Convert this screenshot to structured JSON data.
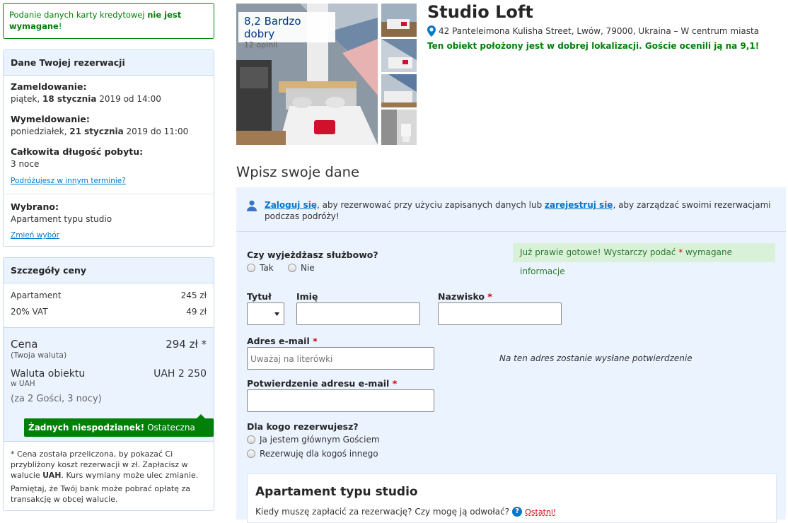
{
  "notice": {
    "pre": "Podanie danych karty kredytowej ",
    "bold": "nie jest wymagane",
    "post": "!"
  },
  "booking": {
    "heading": "Dane Twojej rezerwacji",
    "checkin_label": "Zameldowanie:",
    "checkin_day": "piątek, ",
    "checkin_date": "18 stycznia",
    "checkin_rest": " 2019 od 14:00",
    "checkout_label": "Wymeldowanie:",
    "checkout_day": "poniedziałek, ",
    "checkout_date": "21 stycznia",
    "checkout_rest": " 2019 do 11:00",
    "stay_label": "Całkowita długość pobytu:",
    "stay_value": "3 noce",
    "other_date_link": "Podróżujesz w innym terminie?",
    "selected_label": "Wybrano:",
    "selected_value": "Apartament typu studio",
    "change_link": "Zmień wybór"
  },
  "price": {
    "heading": "Szczegóły ceny",
    "rows": [
      {
        "label": "Apartament",
        "value": "245 zł"
      },
      {
        "label": "20% VAT",
        "value": "49 zł"
      }
    ],
    "total_label": "Cena",
    "total_value": "294 zł *",
    "total_sub": "(Twoja waluta)",
    "local_label": "Waluta obiektu",
    "local_sub": "w UAH",
    "local_value": "UAH 2 250",
    "stay_info": "(za 2 Gości, 3 nocy)",
    "badge_bold": "Żadnych niespodzianek!",
    "badge_rest": " Ostateczna cena.",
    "note1_pre": "* Cena została przeliczona, by pokazać Ci przybliżony koszt rezerwacji w zł. Zapłacisz w walucie ",
    "note1_bold": "UAH",
    "note1_post": ". Kurs wymiany może ulec zmianie.",
    "note2": "Pamiętaj, że Twój bank może pobrać opłatę za transakcję w obcej walucie."
  },
  "hotel": {
    "score": "8,2 Bardzo dobry",
    "reviews": "12 opinii",
    "name": "Studio Loft",
    "address": "42 Panteleimona Kulisha Street, Lwów, 79000, Ukraina – W centrum miasta",
    "location_note": "Ten obiekt położony jest w dobrej lokalizacji. Goście ocenili ją na 9,1!"
  },
  "form": {
    "section_title": "Wpisz swoje dane",
    "login_link": "Zaloguj się",
    "login_mid": ", aby rezerwować przy użyciu zapisanych danych lub ",
    "register_link": "zarejestruj się",
    "login_end": ", aby zarządzać swoimi rezerwacjami podczas podróży!",
    "business_q": "Czy wyjeżdżasz służbowo?",
    "yes": "Tak",
    "no": "Nie",
    "ready_pre": "Już prawie gotowe! Wystarczy podać ",
    "ready_star": "*",
    "ready_post": " wymagane informacje",
    "title_label": "Tytuł",
    "first_label": "Imię",
    "last_label": "Nazwisko",
    "email_label": "Adres e-mail",
    "email_placeholder": "Uważaj na literówki",
    "email_note": "Na ten adres zostanie wysłane potwierdzenie",
    "confirm_label": "Potwierdzenie adresu e-mail",
    "required_mark": "*",
    "for_whom_q": "Dla kogo rezerwujesz?",
    "opt_main": "Ja jestem głównym Gościem",
    "opt_other": "Rezerwuję dla kogoś innego",
    "unit_title": "Apartament typu studio",
    "unit_question": "Kiedy muszę zapłacić za rezerwację? Czy mogę ją odwołać?",
    "last_label_badge": "Ostatni!"
  },
  "colors": {
    "green": "#008009",
    "blue_link": "#0077cc",
    "panel_blue": "#ebf3ff",
    "required_red": "#cc0000"
  }
}
